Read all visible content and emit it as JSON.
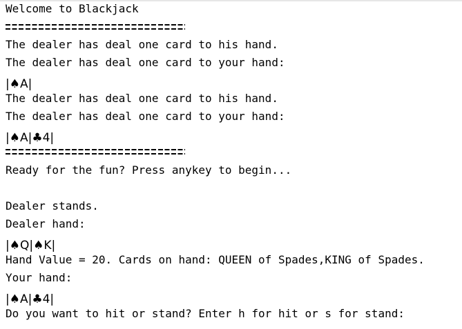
{
  "console": {
    "lines": {
      "welcome": "Welcome to Blackjack",
      "dealer_deal_1": "The dealer has deal one card to his hand.",
      "player_deal_1": "The dealer has deal one card to your hand:",
      "player_cards_1": "|♠A|",
      "dealer_deal_2": "The dealer has deal one card to his hand.",
      "player_deal_2": "The dealer has deal one card to your hand:",
      "player_cards_2": "|♠A|♣4|",
      "ready_prompt": "Ready for the fun? Press anykey to begin...",
      "dealer_stands": "Dealer stands.",
      "dealer_hand_label": "Dealer hand:",
      "dealer_cards": "|♠Q|♠K|",
      "dealer_hand_value": "Hand Value = 20. Cards on hand: QUEEN of Spades,KING of Spades.",
      "your_hand_label": "Your hand:",
      "your_cards": "|♠A|♣4|",
      "hit_stand_prompt": "Do you want to hit or stand? Enter h for hit or s for stand:"
    }
  }
}
